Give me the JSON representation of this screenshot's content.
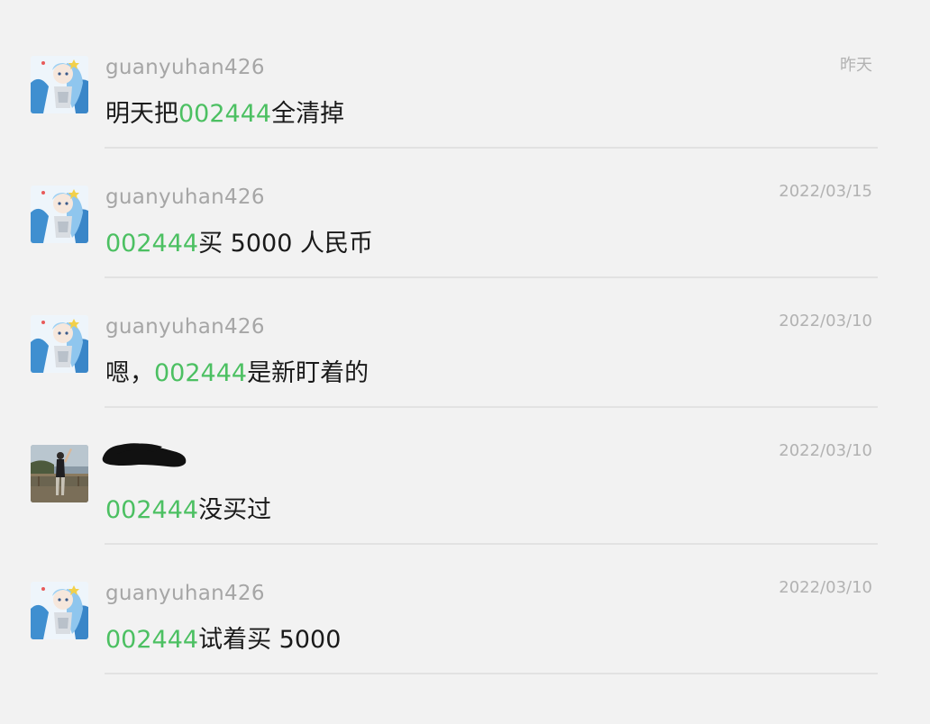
{
  "messages": [
    {
      "sender": "guanyuhan426",
      "date": "昨天",
      "avatar": "anime-avatar",
      "text": {
        "before": "明天把",
        "code": "002444",
        "after": "全清掉"
      }
    },
    {
      "sender": "guanyuhan426",
      "date": "2022/03/15",
      "avatar": "anime-avatar",
      "text": {
        "before": "",
        "code": "002444",
        "after": "买 5000 人民币"
      }
    },
    {
      "sender": "guanyuhan426",
      "date": "2022/03/10",
      "avatar": "anime-avatar",
      "text": {
        "before": "嗯，",
        "code": "002444",
        "after": "是新盯着的"
      }
    },
    {
      "sender": "",
      "sender_redacted": true,
      "date": "2022/03/10",
      "avatar": "photo-avatar",
      "text": {
        "before": "",
        "code": "002444",
        "after": "没买过"
      }
    },
    {
      "sender": "guanyuhan426",
      "date": "2022/03/10",
      "avatar": "anime-avatar",
      "text": {
        "before": "",
        "code": "002444",
        "after": "试着买 5000"
      }
    }
  ],
  "colors": {
    "background": "#f2f2f2",
    "highlight": "#4cc062",
    "sender": "#a6a6a6",
    "date": "#b2b2b2",
    "text": "#1a1a1a",
    "separator": "#e2e2e2"
  }
}
